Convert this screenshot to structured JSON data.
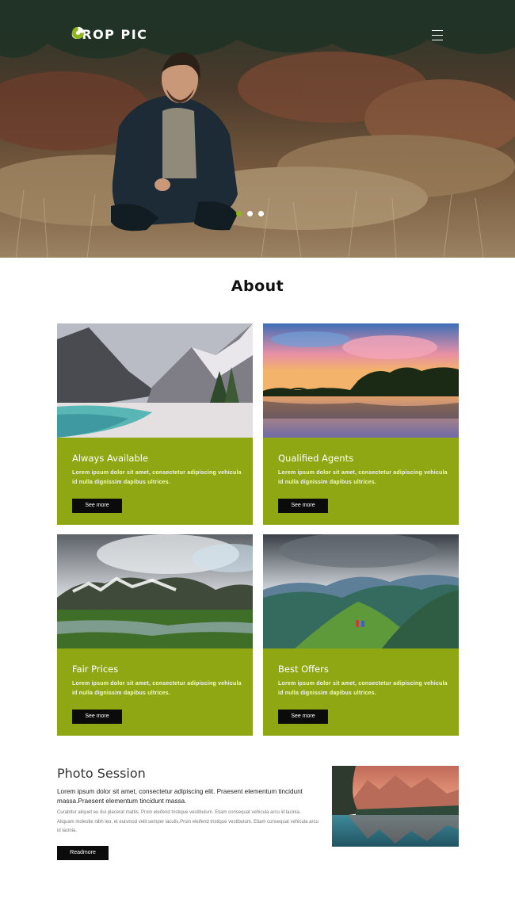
{
  "header": {
    "logo_text": "CROP PIC",
    "logo_icon": "leaf-circle-icon",
    "menu_icon": "hamburger-menu-icon",
    "accent_color": "#8fb61a"
  },
  "hero": {
    "slides": 3,
    "active_slide": 1
  },
  "about": {
    "title": "About",
    "cards": [
      {
        "title": "Always Available",
        "desc": "Lorem ipsum dolor sit amet, consectetur adipiscing vehicula id nulla dignissim dapibus ultrices.",
        "button": "See more"
      },
      {
        "title": "Qualified Agents",
        "desc": "Lorem ipsum dolor sit amet, consectetur adipiscing vehicula id nulla dignissim dapibus ultrices.",
        "button": "See more"
      },
      {
        "title": "Fair Prices",
        "desc": "Lorem ipsum dolor sit amet, consectetur adipiscing vehicula id nulla dignissim dapibus ultrices.",
        "button": "See more"
      },
      {
        "title": "Best Offers",
        "desc": "Lorem ipsum dolor sit amet, consectetur adipiscing vehicula id nulla dignissim dapibus ultrices.",
        "button": "See more"
      }
    ],
    "card_color": "#8fa712"
  },
  "photo_session": {
    "title": "Photo Session",
    "lead": "Lorem ipsum dolor sit amet, consectetur adipiscing elit. Praesent elementum tincidunt massa.Praesent elementum tincidunt massa.",
    "body": "Curabitur aliquet eu dui placerat mattis. Proin eleifend tristique vestibulum. Etiam consequat vehicula arcu id lacinia. Aliquam molestie nibh leo, et euismod velit semper iaculis.Proin eleifend tristique vestibulum. Etiam consequat vehicula arcu id lacinia.",
    "button": "Readmore"
  }
}
